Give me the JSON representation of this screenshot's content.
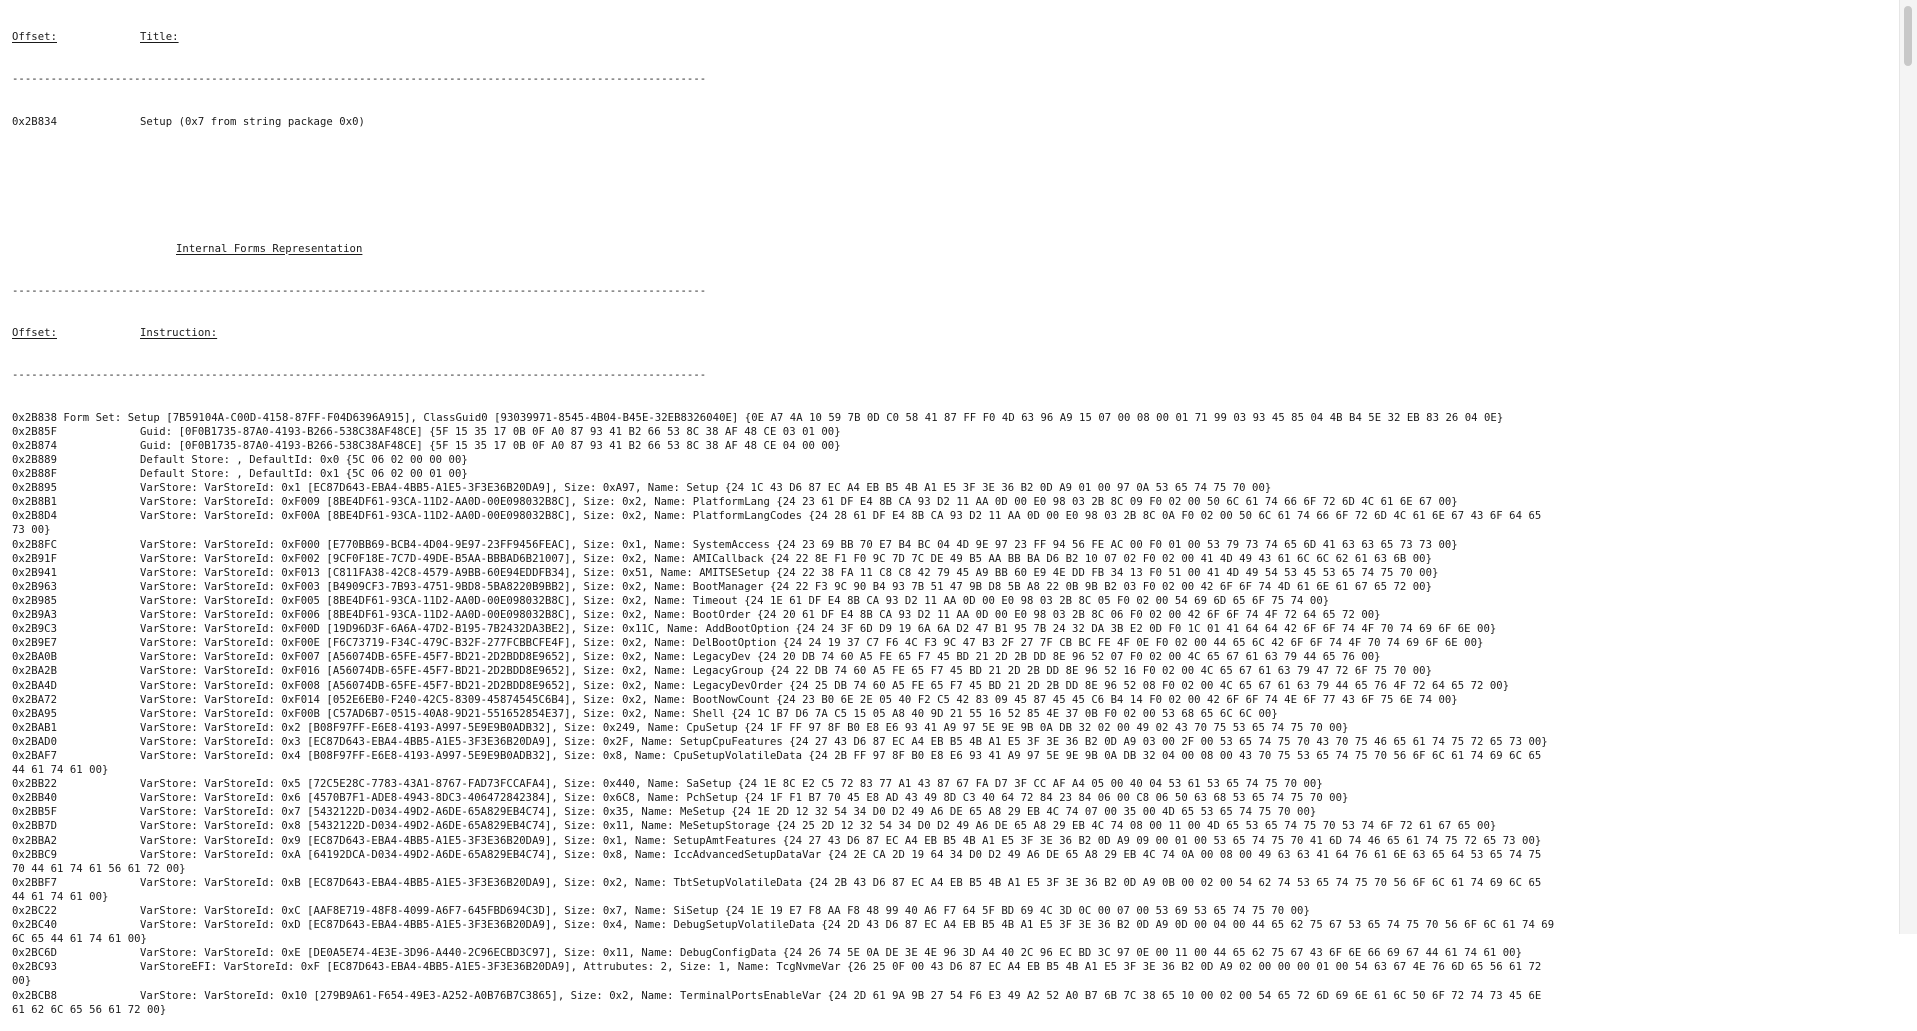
{
  "header": {
    "offset_label": "Offset:",
    "title_label": "Title:",
    "separator": "------------------------------------------------------------------------------------------------------------",
    "title_offset": "0x2B834",
    "title_value": "Setup (0x7 from string package 0x0)"
  },
  "section": {
    "heading": "Internal Forms Representation",
    "offset_label": "Offset:",
    "instruction_label": "Instruction:",
    "separator": "------------------------------------------------------------------------------------------------------------"
  },
  "rows": [
    {
      "offset": "0x2B838",
      "text": " Form Set: Setup [7B59104A-C00D-4158-87FF-F04D6396A915], ClassGuid0 [93039971-8545-4B04-B45E-32EB8326040E] {0E A7 4A 10 59 7B 0D C0 58 41 87 FF F0 4D 63 96 A9 15 07 00 08 00 01 71 99 03 93 45 85 04 4B B4 5E 32 EB 83 26 04 0E}",
      "inline": true
    },
    {
      "offset": "0x2B85F",
      "text": "Guid: [0F0B1735-87A0-4193-B266-538C38AF48CE] {5F 15 35 17 0B 0F A0 87 93 41 B2 66 53 8C 38 AF 48 CE 03 01 00}"
    },
    {
      "offset": "0x2B874",
      "text": "Guid: [0F0B1735-87A0-4193-B266-538C38AF48CE] {5F 15 35 17 0B 0F A0 87 93 41 B2 66 53 8C 38 AF 48 CE 04 00 00}"
    },
    {
      "offset": "0x2B889",
      "text": "Default Store: , DefaultId: 0x0 {5C 06 02 00 00 00}"
    },
    {
      "offset": "0x2B88F",
      "text": "Default Store: , DefaultId: 0x1 {5C 06 02 00 01 00}"
    },
    {
      "offset": "0x2B895",
      "text": "VarStore: VarStoreId: 0x1 [EC87D643-EBA4-4BB5-A1E5-3F3E36B20DA9], Size: 0xA97, Name: Setup {24 1C 43 D6 87 EC A4 EB B5 4B A1 E5 3F 3E 36 B2 0D A9 01 00 97 0A 53 65 74 75 70 00}"
    },
    {
      "offset": "0x2B8B1",
      "text": "VarStore: VarStoreId: 0xF009 [8BE4DF61-93CA-11D2-AA0D-00E098032B8C], Size: 0x2, Name: PlatformLang {24 23 61 DF E4 8B CA 93 D2 11 AA 0D 00 E0 98 03 2B 8C 09 F0 02 00 50 6C 61 74 66 6F 72 6D 4C 61 6E 67 00}"
    },
    {
      "offset": "0x2B8D4",
      "text": "VarStore: VarStoreId: 0xF00A [8BE4DF61-93CA-11D2-AA0D-00E098032B8C], Size: 0x2, Name: PlatformLangCodes {24 28 61 DF E4 8B CA 93 D2 11 AA 0D 00 E0 98 03 2B 8C 0A F0 02 00 50 6C 61 74 66 6F 72 6D 4C 61 6E 67 43 6F 64 65",
      "cont": "73 00}"
    },
    {
      "offset": "0x2B8FC",
      "text": "VarStore: VarStoreId: 0xF000 [E770BB69-BCB4-4D04-9E97-23FF9456FEAC], Size: 0x1, Name: SystemAccess {24 23 69 BB 70 E7 B4 BC 04 4D 9E 97 23 FF 94 56 FE AC 00 F0 01 00 53 79 73 74 65 6D 41 63 63 65 73 73 00}"
    },
    {
      "offset": "0x2B91F",
      "text": "VarStore: VarStoreId: 0xF002 [9CF0F18E-7C7D-49DE-B5AA-BBBAD6B21007], Size: 0x2, Name: AMICallback {24 22 8E F1 F0 9C 7D 7C DE 49 B5 AA BB BA D6 B2 10 07 02 F0 02 00 41 4D 49 43 61 6C 6C 62 61 63 6B 00}"
    },
    {
      "offset": "0x2B941",
      "text": "VarStore: VarStoreId: 0xF013 [C811FA38-42C8-4579-A9BB-60E94EDDFB34], Size: 0x51, Name: AMITSESetup {24 22 38 FA 11 C8 C8 42 79 45 A9 BB 60 E9 4E DD FB 34 13 F0 51 00 41 4D 49 54 53 45 53 65 74 75 70 00}"
    },
    {
      "offset": "0x2B963",
      "text": "VarStore: VarStoreId: 0xF003 [B4909CF3-7B93-4751-9BD8-5BA8220B9BB2], Size: 0x2, Name: BootManager {24 22 F3 9C 90 B4 93 7B 51 47 9B D8 5B A8 22 0B 9B B2 03 F0 02 00 42 6F 6F 74 4D 61 6E 61 67 65 72 00}"
    },
    {
      "offset": "0x2B985",
      "text": "VarStore: VarStoreId: 0xF005 [8BE4DF61-93CA-11D2-AA0D-00E098032B8C], Size: 0x2, Name: Timeout {24 1E 61 DF E4 8B CA 93 D2 11 AA 0D 00 E0 98 03 2B 8C 05 F0 02 00 54 69 6D 65 6F 75 74 00}"
    },
    {
      "offset": "0x2B9A3",
      "text": "VarStore: VarStoreId: 0xF006 [8BE4DF61-93CA-11D2-AA0D-00E098032B8C], Size: 0x2, Name: BootOrder {24 20 61 DF E4 8B CA 93 D2 11 AA 0D 00 E0 98 03 2B 8C 06 F0 02 00 42 6F 6F 74 4F 72 64 65 72 00}"
    },
    {
      "offset": "0x2B9C3",
      "text": "VarStore: VarStoreId: 0xF00D [19D96D3F-6A6A-47D2-B195-7B2432DA3BE2], Size: 0x11C, Name: AddBootOption {24 24 3F 6D D9 19 6A 6A D2 47 B1 95 7B 24 32 DA 3B E2 0D F0 1C 01 41 64 64 42 6F 6F 74 4F 70 74 69 6F 6E 00}"
    },
    {
      "offset": "0x2B9E7",
      "text": "VarStore: VarStoreId: 0xF00E [F6C73719-F34C-479C-B32F-277FCBBCFE4F], Size: 0x2, Name: DelBootOption {24 24 19 37 C7 F6 4C F3 9C 47 B3 2F 27 7F CB BC FE 4F 0E F0 02 00 44 65 6C 42 6F 6F 74 4F 70 74 69 6F 6E 00}"
    },
    {
      "offset": "0x2BA0B",
      "text": "VarStore: VarStoreId: 0xF007 [A56074DB-65FE-45F7-BD21-2D2BDD8E9652], Size: 0x2, Name: LegacyDev {24 20 DB 74 60 A5 FE 65 F7 45 BD 21 2D 2B DD 8E 96 52 07 F0 02 00 4C 65 67 61 63 79 44 65 76 00}"
    },
    {
      "offset": "0x2BA2B",
      "text": "VarStore: VarStoreId: 0xF016 [A56074DB-65FE-45F7-BD21-2D2BDD8E9652], Size: 0x2, Name: LegacyGroup {24 22 DB 74 60 A5 FE 65 F7 45 BD 21 2D 2B DD 8E 96 52 16 F0 02 00 4C 65 67 61 63 79 47 72 6F 75 70 00}"
    },
    {
      "offset": "0x2BA4D",
      "text": "VarStore: VarStoreId: 0xF008 [A56074DB-65FE-45F7-BD21-2D2BDD8E9652], Size: 0x2, Name: LegacyDevOrder {24 25 DB 74 60 A5 FE 65 F7 45 BD 21 2D 2B DD 8E 96 52 08 F0 02 00 4C 65 67 61 63 79 44 65 76 4F 72 64 65 72 00}"
    },
    {
      "offset": "0x2BA72",
      "text": "VarStore: VarStoreId: 0xF014 [052E6EB0-F240-42C5-8309-45874545C6B4], Size: 0x2, Name: BootNowCount {24 23 B0 6E 2E 05 40 F2 C5 42 83 09 45 87 45 45 C6 B4 14 F0 02 00 42 6F 6F 74 4E 6F 77 43 6F 75 6E 74 00}"
    },
    {
      "offset": "0x2BA95",
      "text": "VarStore: VarStoreId: 0xF00B [C57AD6B7-0515-40A8-9D21-551652854E37], Size: 0x2, Name: Shell {24 1C B7 D6 7A C5 15 05 A8 40 9D 21 55 16 52 85 4E 37 0B F0 02 00 53 68 65 6C 6C 00}"
    },
    {
      "offset": "0x2BAB1",
      "text": "VarStore: VarStoreId: 0x2 [B08F97FF-E6E8-4193-A997-5E9E9B0ADB32], Size: 0x249, Name: CpuSetup {24 1F FF 97 8F B0 E8 E6 93 41 A9 97 5E 9E 9B 0A DB 32 02 00 49 02 43 70 75 53 65 74 75 70 00}"
    },
    {
      "offset": "0x2BAD0",
      "text": "VarStore: VarStoreId: 0x3 [EC87D643-EBA4-4BB5-A1E5-3F3E36B20DA9], Size: 0x2F, Name: SetupCpuFeatures {24 27 43 D6 87 EC A4 EB B5 4B A1 E5 3F 3E 36 B2 0D A9 03 00 2F 00 53 65 74 75 70 43 70 75 46 65 61 74 75 72 65 73 00}"
    },
    {
      "offset": "0x2BAF7",
      "text": "VarStore: VarStoreId: 0x4 [B08F97FF-E6E8-4193-A997-5E9E9B0ADB32], Size: 0x8, Name: CpuSetupVolatileData {24 2B FF 97 8F B0 E8 E6 93 41 A9 97 5E 9E 9B 0A DB 32 04 00 08 00 43 70 75 53 65 74 75 70 56 6F 6C 61 74 69 6C 65",
      "cont": "44 61 74 61 00}"
    },
    {
      "offset": "0x2BB22",
      "text": "VarStore: VarStoreId: 0x5 [72C5E28C-7783-43A1-8767-FAD73FCCAFA4], Size: 0x440, Name: SaSetup {24 1E 8C E2 C5 72 83 77 A1 43 87 67 FA D7 3F CC AF A4 05 00 40 04 53 61 53 65 74 75 70 00}"
    },
    {
      "offset": "0x2BB40",
      "text": "VarStore: VarStoreId: 0x6 [4570B7F1-ADE8-4943-8DC3-406472842384], Size: 0x6C8, Name: PchSetup {24 1F F1 B7 70 45 E8 AD 43 49 8D C3 40 64 72 84 23 84 06 00 C8 06 50 63 68 53 65 74 75 70 00}"
    },
    {
      "offset": "0x2BB5F",
      "text": "VarStore: VarStoreId: 0x7 [5432122D-D034-49D2-A6DE-65A829EB4C74], Size: 0x35, Name: MeSetup {24 1E 2D 12 32 54 34 D0 D2 49 A6 DE 65 A8 29 EB 4C 74 07 00 35 00 4D 65 53 65 74 75 70 00}"
    },
    {
      "offset": "0x2BB7D",
      "text": "VarStore: VarStoreId: 0x8 [5432122D-D034-49D2-A6DE-65A829EB4C74], Size: 0x11, Name: MeSetupStorage {24 25 2D 12 32 54 34 D0 D2 49 A6 DE 65 A8 29 EB 4C 74 08 00 11 00 4D 65 53 65 74 75 70 53 74 6F 72 61 67 65 00}"
    },
    {
      "offset": "0x2BBA2",
      "text": "VarStore: VarStoreId: 0x9 [EC87D643-EBA4-4BB5-A1E5-3F3E36B20DA9], Size: 0x1, Name: SetupAmtFeatures {24 27 43 D6 87 EC A4 EB B5 4B A1 E5 3F 3E 36 B2 0D A9 09 00 01 00 53 65 74 75 70 41 6D 74 46 65 61 74 75 72 65 73 00}"
    },
    {
      "offset": "0x2BBC9",
      "text": "VarStore: VarStoreId: 0xA [64192DCA-D034-49D2-A6DE-65A829EB4C74], Size: 0x8, Name: IccAdvancedSetupDataVar {24 2E CA 2D 19 64 34 D0 D2 49 A6 DE 65 A8 29 EB 4C 74 0A 00 08 00 49 63 63 41 64 76 61 6E 63 65 64 53 65 74 75",
      "cont": "70 44 61 74 61 56 61 72 00}"
    },
    {
      "offset": "0x2BBF7",
      "text": "VarStore: VarStoreId: 0xB [EC87D643-EBA4-4BB5-A1E5-3F3E36B20DA9], Size: 0x2, Name: TbtSetupVolatileData {24 2B 43 D6 87 EC A4 EB B5 4B A1 E5 3F 3E 36 B2 0D A9 0B 00 02 00 54 62 74 53 65 74 75 70 56 6F 6C 61 74 69 6C 65",
      "cont": "44 61 74 61 00}"
    },
    {
      "offset": "0x2BC22",
      "text": "VarStore: VarStoreId: 0xC [AAF8E719-48F8-4099-A6F7-645FBD694C3D], Size: 0x7, Name: SiSetup {24 1E 19 E7 F8 AA F8 48 99 40 A6 F7 64 5F BD 69 4C 3D 0C 00 07 00 53 69 53 65 74 75 70 00}"
    },
    {
      "offset": "0x2BC40",
      "text": "VarStore: VarStoreId: 0xD [EC87D643-EBA4-4BB5-A1E5-3F3E36B20DA9], Size: 0x4, Name: DebugSetupVolatileData {24 2D 43 D6 87 EC A4 EB B5 4B A1 E5 3F 3E 36 B2 0D A9 0D 00 04 00 44 65 62 75 67 53 65 74 75 70 56 6F 6C 61 74 69",
      "cont": "6C 65 44 61 74 61 00}"
    },
    {
      "offset": "0x2BC6D",
      "text": "VarStore: VarStoreId: 0xE [DE0A5E74-4E3E-3D96-A440-2C96ECBD3C97], Size: 0x11, Name: DebugConfigData {24 26 74 5E 0A DE 3E 4E 96 3D A4 40 2C 96 EC BD 3C 97 0E 00 11 00 44 65 62 75 67 43 6F 6E 66 69 67 44 61 74 61 00}"
    },
    {
      "offset": "0x2BC93",
      "text": "VarStoreEFI: VarStoreId: 0xF [EC87D643-EBA4-4BB5-A1E5-3F3E36B20DA9], Attrubutes: 2, Size: 1, Name: TcgNvmeVar {26 25 0F 00 43 D6 87 EC A4 EB B5 4B A1 E5 3F 3E 36 B2 0D A9 02 00 00 00 01 00 54 63 67 4E 76 6D 65 56 61 72",
      "cont": "00}"
    },
    {
      "offset": "0x2BCB8",
      "text": "VarStore: VarStoreId: 0x10 [279B9A61-F654-49E3-A252-A0B76B7C3865], Size: 0x2, Name: TerminalPortsEnableVar {24 2D 61 9A 9B 27 54 F6 E3 49 A2 52 A0 B7 6B 7C 38 65 10 00 02 00 54 65 72 6D 69 6E 61 6C 50 6F 72 74 73 45 6E",
      "cont": "61 62 6C 65 56 61 72 00}"
    }
  ]
}
